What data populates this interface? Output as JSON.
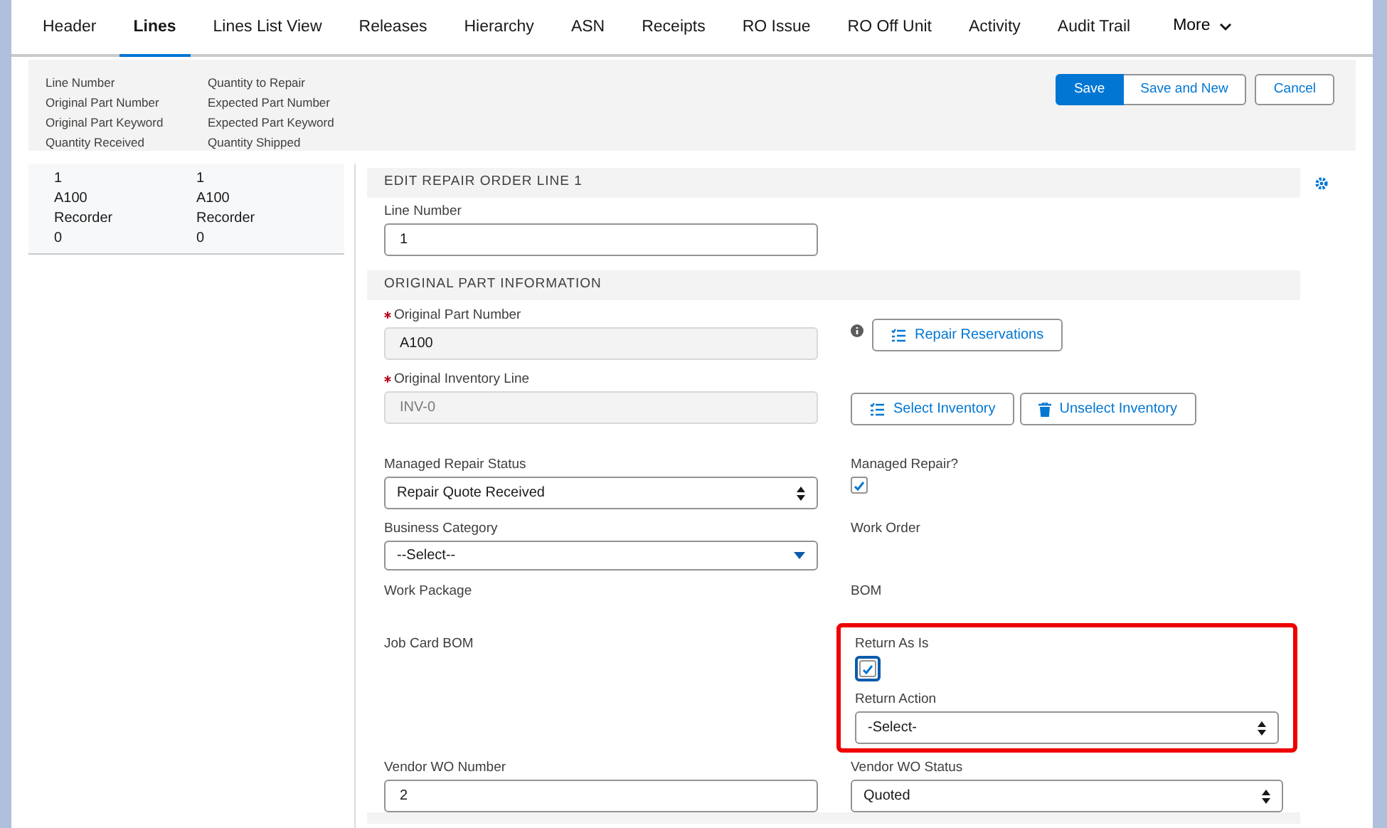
{
  "tabs": [
    {
      "label": "Header",
      "selected": false
    },
    {
      "label": "Lines",
      "selected": true
    },
    {
      "label": "Lines List View",
      "selected": false
    },
    {
      "label": "Releases",
      "selected": false
    },
    {
      "label": "Hierarchy",
      "selected": false
    },
    {
      "label": "ASN",
      "selected": false
    },
    {
      "label": "Receipts",
      "selected": false
    },
    {
      "label": "RO Issue",
      "selected": false
    },
    {
      "label": "RO Off Unit",
      "selected": false
    },
    {
      "label": "Activity",
      "selected": false
    },
    {
      "label": "Audit Trail",
      "selected": false
    }
  ],
  "more_tab": {
    "label": "More"
  },
  "header": {
    "columns": [
      [
        "Line Number",
        "Original Part Number",
        "Original Part Keyword",
        "Quantity Received"
      ],
      [
        "Quantity to Repair",
        "Expected Part Number",
        "Expected Part Keyword",
        "Quantity Shipped"
      ]
    ],
    "buttons": [
      {
        "label": "Save",
        "kind": "primary"
      },
      {
        "label": "Save and New",
        "kind": "neutral"
      },
      {
        "label": "Cancel",
        "kind": "neutral"
      }
    ]
  },
  "summary": {
    "columns": [
      [
        "1",
        "A100",
        "Recorder",
        "0"
      ],
      [
        "1",
        "A100",
        "Recorder",
        "0"
      ]
    ]
  },
  "form": {
    "title": "EDIT REPAIR ORDER LINE 1",
    "line_number": {
      "label": "Line Number",
      "value": "1"
    },
    "section": "ORIGINAL PART INFORMATION",
    "rows": [
      [
        {
          "kind": "input",
          "label": "Original Part Number",
          "required": true,
          "value": "A100",
          "disabled": false,
          "readonly": true
        },
        {
          "kind": "buttons",
          "info": true,
          "buttons": [
            {
              "label": "Repair Reservations",
              "kind": "pick"
            }
          ]
        }
      ],
      [
        {
          "kind": "input",
          "label": "Original Inventory Line",
          "required": true,
          "value": "INV-0",
          "disabled": true,
          "readonly": true
        },
        {
          "kind": "buttons",
          "info": false,
          "buttons": [
            {
              "label": "Select Inventory",
              "kind": "pick"
            },
            {
              "label": "Unselect Inventory",
              "kind": "clear"
            }
          ]
        }
      ],
      [
        {
          "kind": "select",
          "label": "Managed Repair Status",
          "value": "Repair Quote Received"
        },
        {
          "kind": "checkbox",
          "label": "Managed Repair?",
          "checked": true,
          "focused": false
        }
      ],
      [
        {
          "kind": "combobox",
          "label": "Business Category",
          "value": "--Select--"
        },
        {
          "kind": "label",
          "label": "Work Order"
        }
      ],
      [
        {
          "kind": "label",
          "label": "Work Package"
        },
        {
          "kind": "label",
          "label": "BOM"
        }
      ],
      [
        {
          "kind": "label",
          "label": "Job Card BOM"
        },
        {
          "kind": "group",
          "highlighted": true,
          "fields": [
            {
              "kind": "checkbox",
              "label": "Return As Is",
              "checked": true,
              "focused": true
            },
            {
              "kind": "select",
              "label": "Return Action",
              "value": "-Select-"
            }
          ]
        }
      ],
      [
        {
          "kind": "input",
          "label": "Vendor WO Number",
          "required": false,
          "value": "2",
          "disabled": false,
          "readonly": false
        },
        {
          "kind": "select",
          "label": "Vendor WO Status",
          "value": "Quoted"
        }
      ]
    ]
  }
}
